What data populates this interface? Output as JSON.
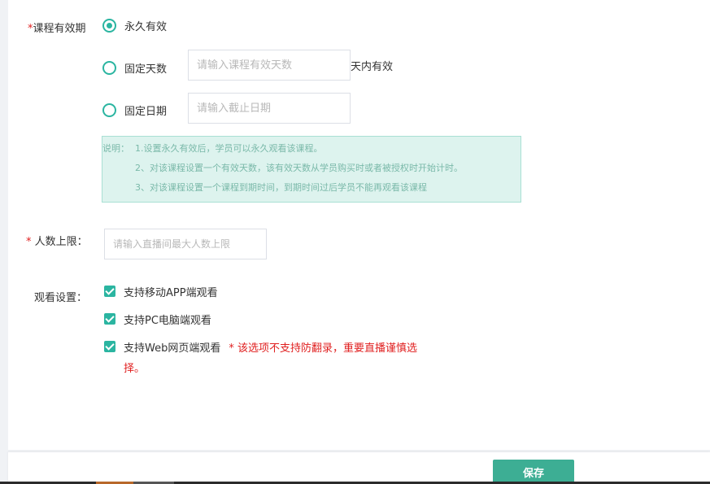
{
  "validity": {
    "label": "课程有效期",
    "required_mark": "*",
    "options": [
      {
        "label": "永久有效",
        "checked": true
      },
      {
        "label": "固定天数",
        "checked": false,
        "placeholder": "请输入课程有效天数",
        "suffix": "天内有效"
      },
      {
        "label": "固定日期",
        "checked": false,
        "placeholder": "请输入截止日期"
      }
    ],
    "notice": {
      "prefix": "说明：",
      "lines": [
        "1.设置永久有效后，学员可以永久观看该课程。",
        "2、对该课程设置一个有效天数，该有效天数从学员购买时或者被授权时开始计时。",
        "3、对该课程设置一个课程到期时间，到期时间过后学员不能再观看该课程"
      ]
    }
  },
  "max_users": {
    "required_mark": "*",
    "label": "人数上限：",
    "placeholder": "请输入直播间最大人数上限"
  },
  "watch_settings": {
    "label": "观看设置：",
    "options": [
      {
        "label": "支持移动APP端观看",
        "checked": true
      },
      {
        "label": "支持PC电脑端观看",
        "checked": true
      },
      {
        "label": "支持Web网页端观看",
        "checked": true
      }
    ],
    "warning_line1": "* 该选项不支持防翻录，重要直播谨慎选",
    "warning_line2": "择。"
  },
  "footer": {
    "save_label": "保存"
  },
  "colors": {
    "accent": "#2bb5a1",
    "save_button": "#3dae94",
    "warning": "#e02020",
    "notice_bg": "#ddf3ee"
  }
}
